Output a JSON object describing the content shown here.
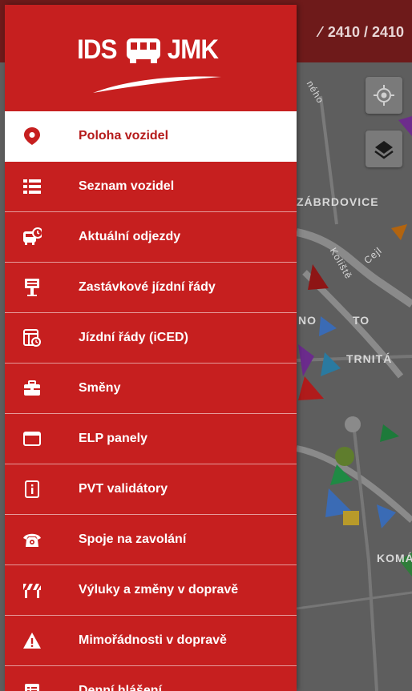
{
  "map": {
    "vehicle_count": "2410 / 2410",
    "labels": {
      "district_1": "ZÁBRDOVICE",
      "district_2": "TRNITÁ",
      "district_3": "KOMÁ",
      "district_4": "NO",
      "district_5": "TO",
      "street_1": "Koliště",
      "street_2": "Cejl",
      "street_3": "ného"
    },
    "locate_button_icon": "crosshair-icon",
    "layers_button_icon": "layers-icon"
  },
  "drawer": {
    "logo": {
      "left": "IDS",
      "right": "JMK",
      "icon": "bus-icon"
    },
    "accent_color": "#c61f1f",
    "items": [
      {
        "label": "Poloha vozidel",
        "icon": "location-pin-icon",
        "active": true
      },
      {
        "label": "Seznam vozidel",
        "icon": "list-icon",
        "active": false
      },
      {
        "label": "Aktuální odjezdy",
        "icon": "bus-clock-icon",
        "active": false
      },
      {
        "label": "Zastávkové jízdní řády",
        "icon": "stop-sign-icon",
        "active": false
      },
      {
        "label": "Jízdní řády (iCED)",
        "icon": "timetable-icon",
        "active": false
      },
      {
        "label": "Směny",
        "icon": "briefcase-icon",
        "active": false
      },
      {
        "label": "ELP panely",
        "icon": "panel-icon",
        "active": false
      },
      {
        "label": "PVT validátory",
        "icon": "validator-icon",
        "active": false
      },
      {
        "label": "Spoje na zavolání",
        "icon": "phone-icon",
        "active": false
      },
      {
        "label": "Výluky a změny v dopravě",
        "icon": "roadblock-icon",
        "active": false
      },
      {
        "label": "Mimořádnosti v dopravě",
        "icon": "warning-icon",
        "active": false
      },
      {
        "label": "Denní hlášení",
        "icon": "report-icon",
        "active": false
      }
    ]
  }
}
